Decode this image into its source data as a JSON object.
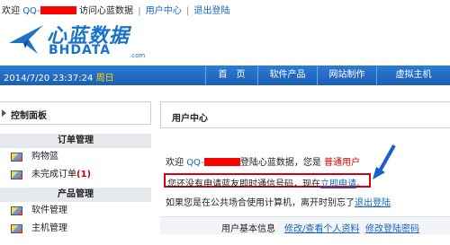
{
  "topbar": {
    "welcome": "欢迎",
    "user_prefix": "QQ-",
    "visit_text": "访问心蓝数据",
    "user_center": "用户中心",
    "separator": "|",
    "logout": "退出登陆"
  },
  "logo": {
    "cn": "心蓝数据",
    "en": "BHDATA",
    "suffix": ".com"
  },
  "navbar": {
    "date": "2014/7/20 23:37:24",
    "weekday": "周日",
    "items": [
      "首　页",
      "软件产品",
      "网站制作",
      "虚拟主机"
    ]
  },
  "sidebar": {
    "header": "控制面板",
    "groups": [
      {
        "title": "订单管理",
        "items": [
          {
            "label": "购物篮",
            "count": ""
          },
          {
            "label": "未完成订单",
            "count": "(1)"
          }
        ]
      },
      {
        "title": "产品管理",
        "items": [
          {
            "label": "软件管理",
            "count": ""
          },
          {
            "label": "主机管理",
            "count": ""
          }
        ]
      }
    ]
  },
  "main": {
    "title": "用户中心",
    "line1": {
      "welcome": "欢迎",
      "user_prefix": "QQ-",
      "after": "登陆心蓝数据，您是",
      "level": "普通用户"
    },
    "notice": {
      "text": "您还没有申请蓝友即时通信号码，现在",
      "link": "立即申请",
      "end": "。"
    },
    "line3": {
      "text": "如果您是在公共场合使用计算机，离开时别忘了",
      "link": "退出登陆"
    },
    "bottom": {
      "label": "用户基本信息",
      "link1": "修改/查看个人资料",
      "link2": "修改登陆密码"
    }
  },
  "colors": {
    "brand": "#1a73c9",
    "nav": "#1a5fb4",
    "highlight": "#d0021b",
    "link": "#1565c0"
  }
}
